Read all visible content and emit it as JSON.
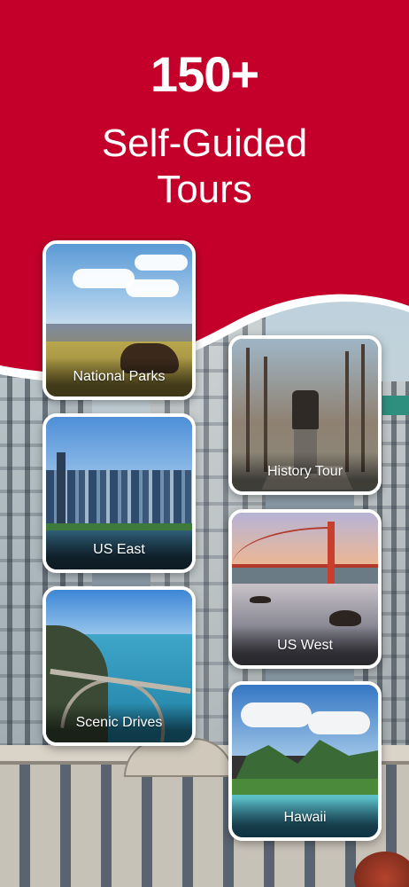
{
  "hero": {
    "number": "150+",
    "line1": "Self-Guided",
    "line2": "Tours"
  },
  "colors": {
    "brand_red": "#c4002a",
    "text": "#ffffff"
  },
  "tours": [
    {
      "label": "National Parks"
    },
    {
      "label": "History Tour"
    },
    {
      "label": "US East"
    },
    {
      "label": "US West"
    },
    {
      "label": "Scenic Drives"
    },
    {
      "label": "Hawaii"
    }
  ]
}
